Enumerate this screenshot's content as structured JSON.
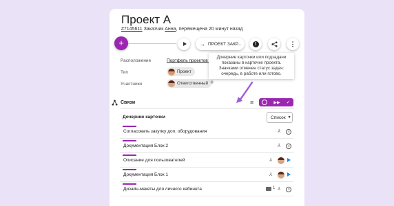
{
  "project": {
    "title": "Проект А",
    "id_link": "#7145611",
    "meta_1": " Заказчик ",
    "customer": "Анна",
    "meta_2": ", перемещена 20 минут назад"
  },
  "toolbar": {
    "add": "+",
    "stage_button": "ПРОЕКТ ЗАКР..."
  },
  "tooltip": "Дочерние карточки или подзадачи показаны в карточке проекта. Значками отмечен статус задач: очередь, в работе или готово.",
  "properties": {
    "location_label": "Расположение",
    "location_value": "Портфель проектов / ...",
    "type_label": "Тип",
    "type_value": "Проект",
    "members_label": "Участники",
    "members_value": "Ответственный",
    "add_member": "+"
  },
  "links": {
    "section_title": "Связи",
    "panel_title": "Дочерние карточки",
    "view_select": "Список",
    "rows": [
      {
        "label": "Согласовать закупку доп. оборудования"
      },
      {
        "label": "Документация Блок 2"
      },
      {
        "label": "Описание для пользователей"
      },
      {
        "label": "Документация Блок 1"
      },
      {
        "label": "Дизайн-макеты для личного кабинета",
        "comments": "1"
      }
    ]
  },
  "colors": {
    "accent": "#9b27b0",
    "background": "#eae2f7",
    "arrow": "#a05ad8"
  }
}
